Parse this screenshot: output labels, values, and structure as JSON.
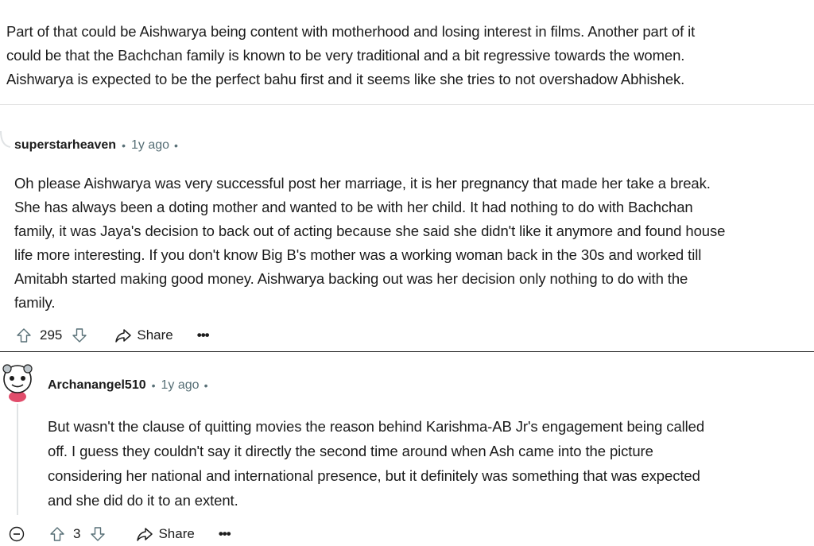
{
  "top_comment": {
    "lines": [
      "Part of that could be Aishwarya being content with motherhood and losing interest in films. Another part of it",
      "could be that the Bachchan family is known to be very traditional and a bit regressive towards the women.",
      "Aishwarya is expected to be the perfect bahu first and it seems like she tries to not overshadow Abhishek."
    ]
  },
  "comment1": {
    "author": "superstarheaven",
    "time": "1y ago",
    "lines": [
      "Oh please Aishwarya was very successful post her marriage, it is her pregnancy that made her take a break.",
      "She has always been a doting mother and wanted to be with her child. It had nothing to do with Bachchan",
      "family, it was Jaya's decision to back out of acting because she said she didn't like it anymore and found house",
      "life more interesting. If you don't know Big B's mother was a working woman back in the 30s and worked till",
      "Amitabh started making good money. Aishwarya backing out was her decision only nothing to do with the",
      "family."
    ],
    "upvotes": "295",
    "share_label": "Share",
    "more_label": "•••"
  },
  "comment2": {
    "author": "Archanangel510",
    "time": "1y ago",
    "lines": [
      "But wasn't the clause of quitting movies the reason behind Karishma-AB Jr's engagement being called",
      "off. I guess they couldn't say it directly the second time around when Ash came into the picture",
      "considering her national and international presence, but it definitely was something that was expected",
      "and she did do it to an extent."
    ],
    "upvotes": "3",
    "share_label": "Share",
    "more_label": "•••"
  },
  "separator_dot": "•",
  "icons": [
    "upvote-icon",
    "downvote-icon",
    "share-icon",
    "more-icon",
    "collapse-icon",
    "avatar"
  ],
  "colors": {
    "text": "#1c1c1c",
    "meta": "#576f76",
    "icon": "#576f76",
    "divider": "#e5e5e5"
  }
}
